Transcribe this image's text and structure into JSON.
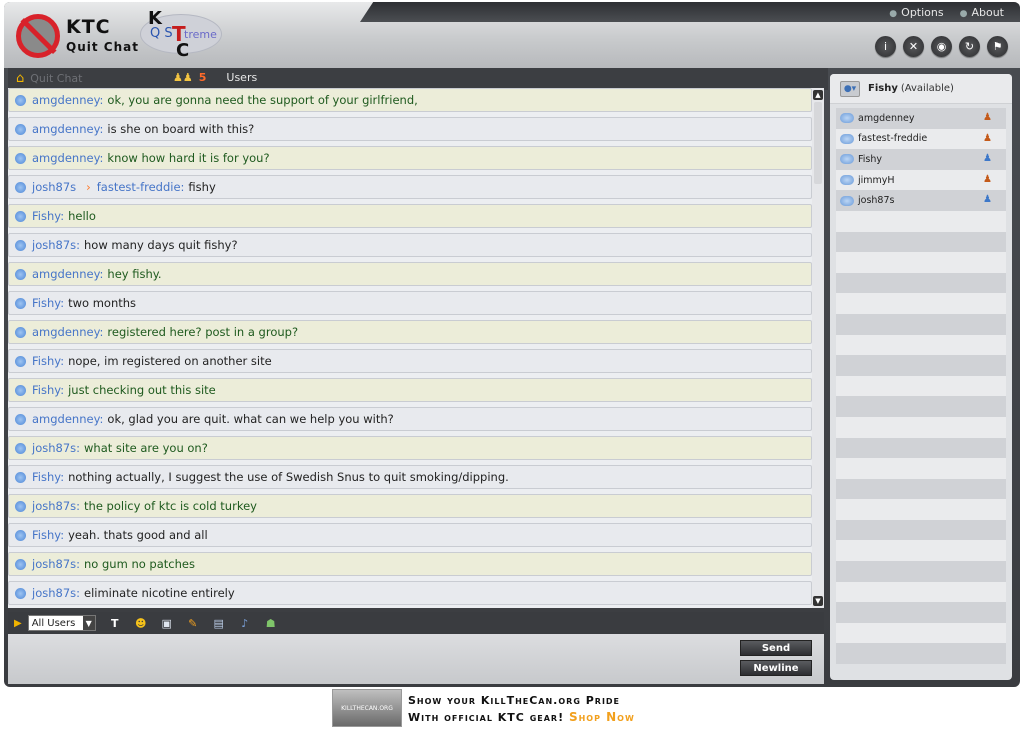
{
  "app": {
    "logo_ktc": "KTC",
    "logo_quitchat": "Quit Chat",
    "logo_k": "K",
    "logo_qs": "Q S",
    "logo_t": "T",
    "logo_treme": "treme",
    "logo_c": "C"
  },
  "top_links": {
    "options": "Options",
    "about": "About"
  },
  "header_buttons": [
    "info-icon",
    "mute-icon",
    "chat-icon",
    "refresh-icon",
    "exit-icon"
  ],
  "tabs": {
    "home_label": "Quit Chat",
    "users_count": "5",
    "users_label": "Users"
  },
  "messages": [
    {
      "sender": "amgdenney:",
      "text": "ok, you are gonna need the support of your girlfriend,",
      "style": "alt"
    },
    {
      "sender": "amgdenney:",
      "text": "is she on board with this?",
      "style": "norm"
    },
    {
      "sender": "amgdenney:",
      "text": "know how hard it is for you?",
      "style": "alt"
    },
    {
      "sender": "josh87s",
      "to": "fastest-freddie:",
      "text": "fishy",
      "style": "norm"
    },
    {
      "sender": "Fishy:",
      "text": "hello",
      "style": "alt"
    },
    {
      "sender": "josh87s:",
      "text": "how many days quit fishy?",
      "style": "norm"
    },
    {
      "sender": "amgdenney:",
      "text": "hey fishy.",
      "style": "alt"
    },
    {
      "sender": "Fishy:",
      "text": "two months",
      "style": "norm"
    },
    {
      "sender": "amgdenney:",
      "text": "registered here? post in a group?",
      "style": "alt"
    },
    {
      "sender": "Fishy:",
      "text": "nope, im registered on another site",
      "style": "norm"
    },
    {
      "sender": "Fishy:",
      "text": "just checking out this site",
      "style": "alt"
    },
    {
      "sender": "amgdenney:",
      "text": "ok, glad you are quit. what can we help you with?",
      "style": "norm"
    },
    {
      "sender": "josh87s:",
      "text": "what site are you on?",
      "style": "alt"
    },
    {
      "sender": "Fishy:",
      "text": "nothing actually, I suggest the use of Swedish Snus to quit smoking/dipping.",
      "style": "norm"
    },
    {
      "sender": "josh87s:",
      "text": "the policy of ktc is cold turkey",
      "style": "alt"
    },
    {
      "sender": "Fishy:",
      "text": "yeah. thats good and all",
      "style": "norm"
    },
    {
      "sender": "josh87s:",
      "text": "no gum no patches",
      "style": "alt"
    },
    {
      "sender": "josh87s:",
      "text": "eliminate nicotine entirely",
      "style": "norm"
    }
  ],
  "toolbar": {
    "recipient": "All Users",
    "icons": [
      "text-format-icon",
      "smiley-icon",
      "image-icon",
      "paint-icon",
      "document-icon",
      "music-icon",
      "users-icon"
    ]
  },
  "input": {
    "send": "Send",
    "newline": "Newline"
  },
  "user_panel": {
    "current_name": "Fishy",
    "current_status": "(Available)",
    "users": [
      {
        "name": "amgdenney",
        "gender": "f"
      },
      {
        "name": "fastest-freddie",
        "gender": "f"
      },
      {
        "name": "Fishy",
        "gender": "m"
      },
      {
        "name": "jimmyH",
        "gender": "f"
      },
      {
        "name": "josh87s",
        "gender": "m"
      }
    ]
  },
  "banner": {
    "thumb_text": "KILLTHECAN.ORG",
    "line1": "Show your KillTheCan.org Pride",
    "line2": "With official KTC gear!",
    "shop": "Shop Now"
  }
}
